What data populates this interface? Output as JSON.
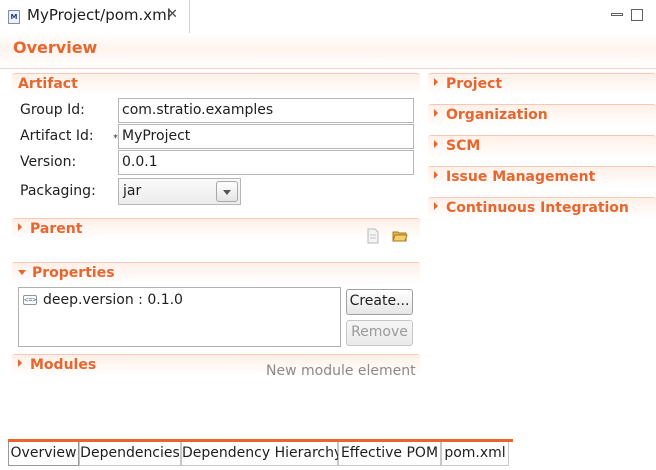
{
  "editor": {
    "tab_title": "MyProject/pom.xml",
    "file_icon_letter": "M"
  },
  "page": {
    "title": "Overview"
  },
  "artifact": {
    "section_title": "Artifact",
    "group_id_label": "Group Id:",
    "group_id_value": "com.stratio.examples",
    "artifact_id_label": "Artifact Id:",
    "artifact_id_value": "MyProject",
    "required_marker": "*",
    "version_label": "Version:",
    "version_value": "0.0.1",
    "packaging_label": "Packaging:",
    "packaging_value": "jar"
  },
  "parent": {
    "section_title": "Parent"
  },
  "properties": {
    "section_title": "Properties",
    "items": [
      {
        "text": "deep.version : 0.1.0",
        "icon": "property-icon"
      }
    ],
    "create_label": "Create...",
    "remove_label": "Remove"
  },
  "modules": {
    "section_title": "Modules",
    "new_element_hint": "New module element"
  },
  "right_sections": {
    "project": "Project",
    "organization": "Organization",
    "scm": "SCM",
    "issue_management": "Issue Management",
    "continuous_integration": "Continuous Integration"
  },
  "bottom_tabs": [
    {
      "label": "Overview",
      "active": true
    },
    {
      "label": "Dependencies",
      "active": false
    },
    {
      "label": "Dependency Hierarchy",
      "active": false
    },
    {
      "label": "Effective POM",
      "active": false
    },
    {
      "label": "pom.xml",
      "active": false
    }
  ],
  "colors": {
    "accent": "#e8662e",
    "section_border": "#f5c9b4",
    "disabled_text": "#9a9a9a"
  }
}
